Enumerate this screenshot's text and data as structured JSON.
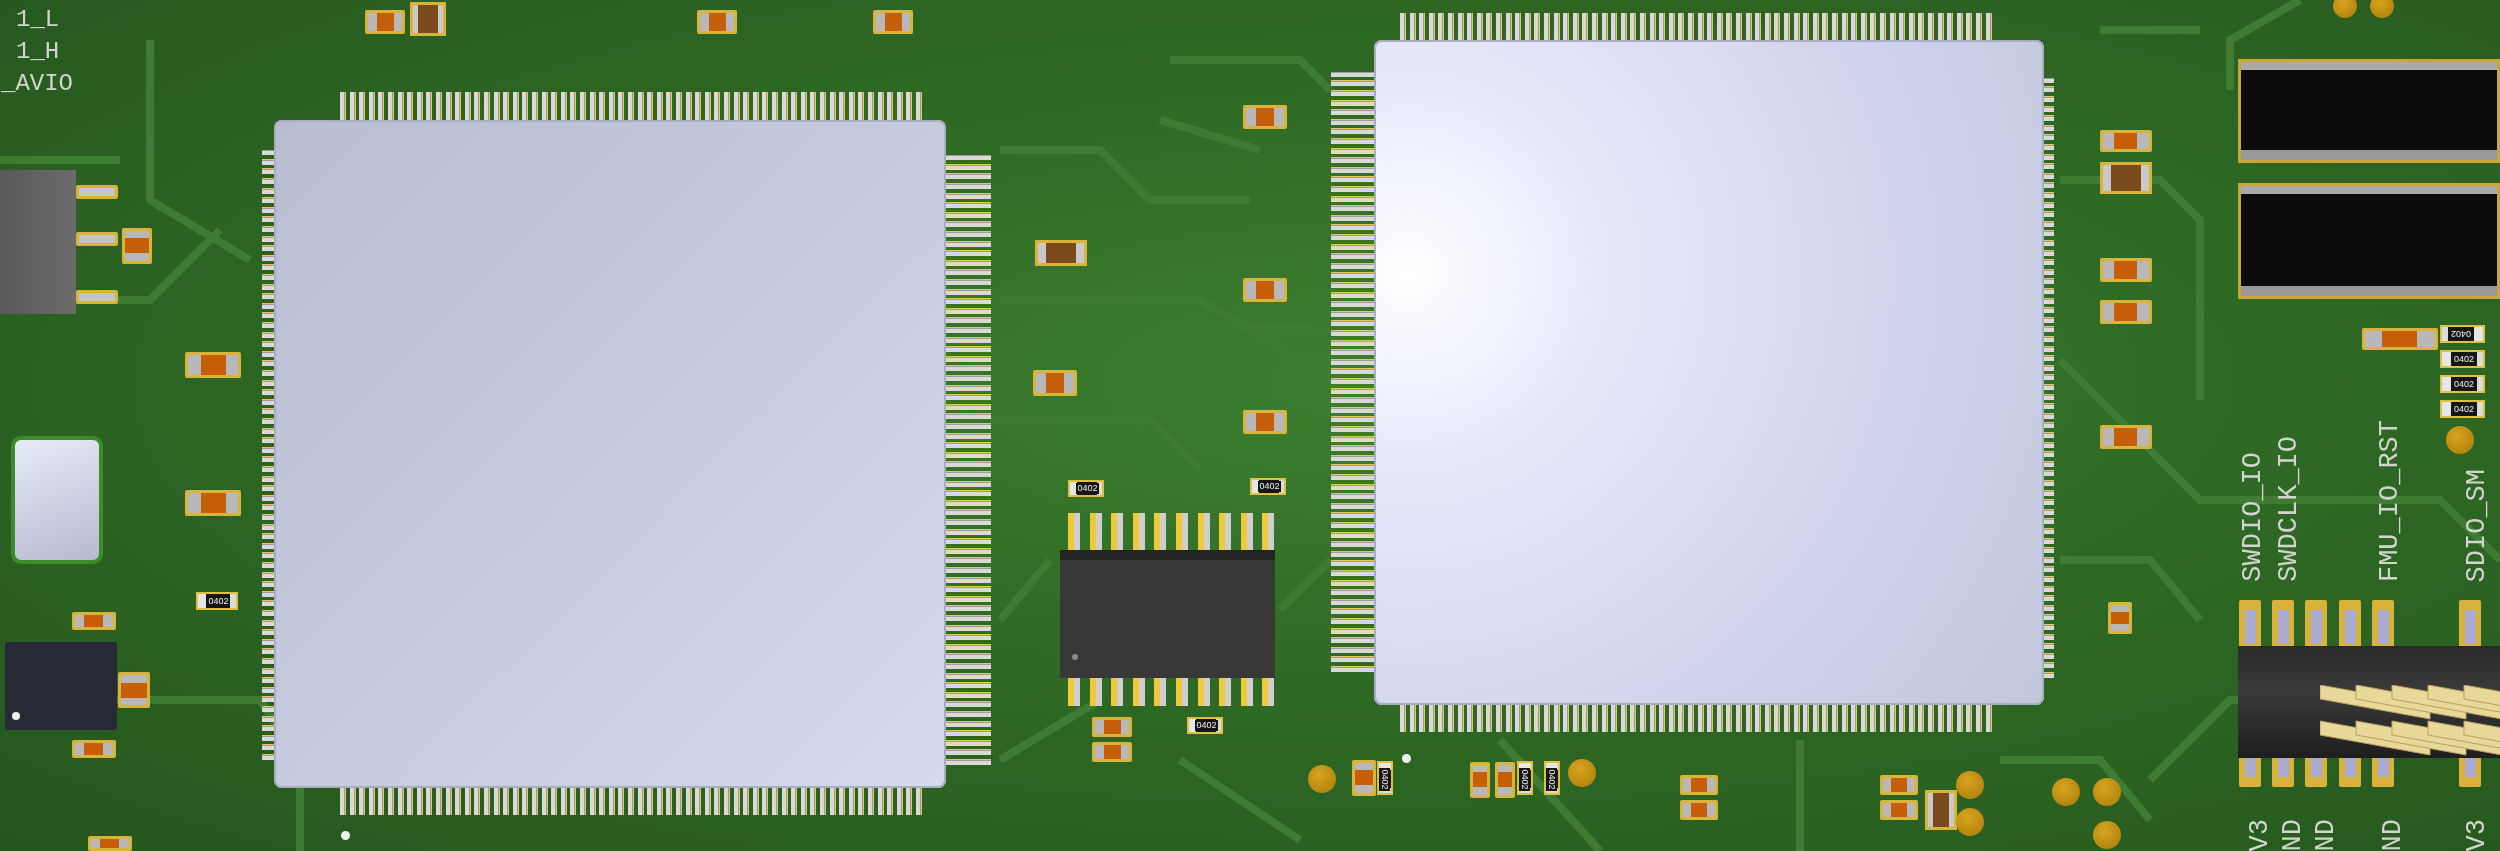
{
  "board": {
    "net_labels": [
      {
        "text": "1_L"
      },
      {
        "text": "1_H"
      },
      {
        "text": "_AVIO"
      }
    ],
    "header_labels": {
      "top": [
        "SWDIO_IO",
        "SWDCLK_IO",
        "FMU_IO_RST",
        "SDIO_SM"
      ],
      "bottom": [
        "V3",
        "ND",
        "ND",
        "ND",
        "V3"
      ]
    },
    "resistors": [
      {
        "marking": "0402"
      },
      {
        "marking": "0402"
      },
      {
        "marking": "0402"
      },
      {
        "marking": "0402"
      },
      {
        "marking": "0402"
      },
      {
        "marking": "0402"
      },
      {
        "marking": "0402"
      },
      {
        "marking": "0402"
      },
      {
        "marking": "0402"
      },
      {
        "marking": "0402"
      },
      {
        "marking": "0402"
      }
    ]
  }
}
